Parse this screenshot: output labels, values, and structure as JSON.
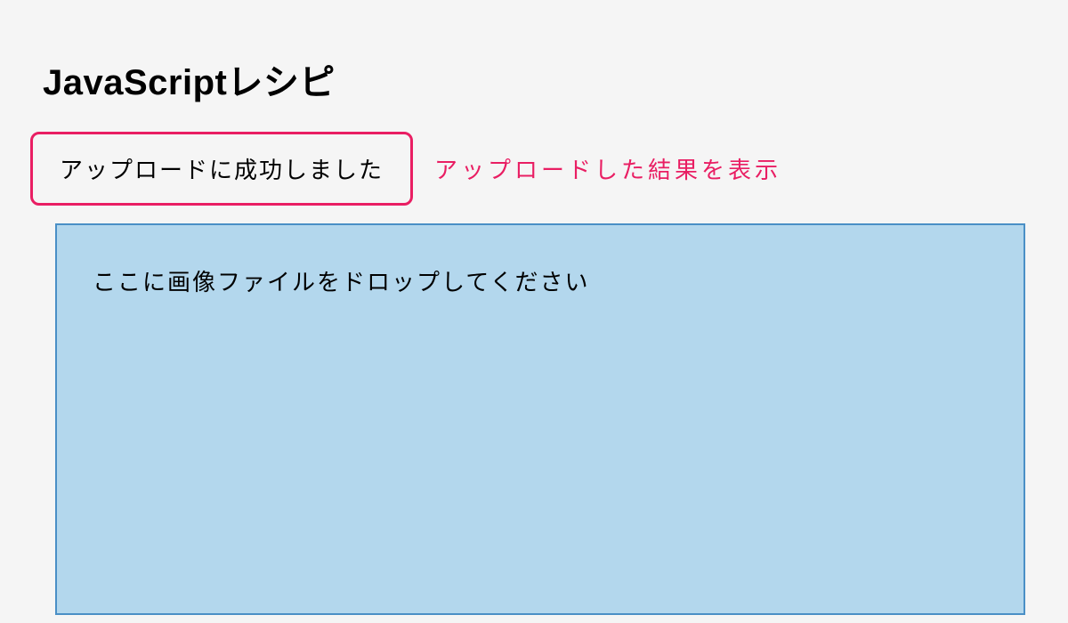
{
  "header": {
    "title": "JavaScriptレシピ"
  },
  "status": {
    "message": "アップロードに成功しました",
    "annotation": "アップロードした結果を表示"
  },
  "dropzone": {
    "instruction": "ここに画像ファイルをドロップしてください"
  }
}
